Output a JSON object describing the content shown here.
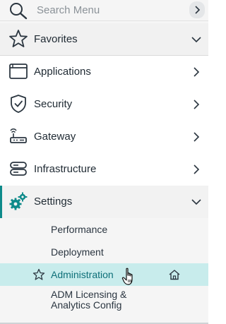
{
  "search": {
    "placeholder": "Search Menu"
  },
  "favorites": {
    "label": "Favorites"
  },
  "nav": {
    "applications": {
      "label": "Applications"
    },
    "security": {
      "label": "Security"
    },
    "gateway": {
      "label": "Gateway"
    },
    "infrastructure": {
      "label": "Infrastructure"
    },
    "settings": {
      "label": "Settings"
    }
  },
  "settings_sub": {
    "performance": "Performance",
    "deployment": "Deployment",
    "administration": "Administration",
    "adm_licensing": "ADM Licensing & Analytics Config"
  },
  "colors": {
    "accent": "#0e8a8a",
    "active_bg": "#c8ecec",
    "active_text": "#0d6f78"
  },
  "icons": [
    "search-icon",
    "star-icon",
    "window-icon",
    "shield-check-icon",
    "gateway-icon",
    "servers-icon",
    "gears-icon",
    "home-icon",
    "hand-cursor-icon"
  ]
}
